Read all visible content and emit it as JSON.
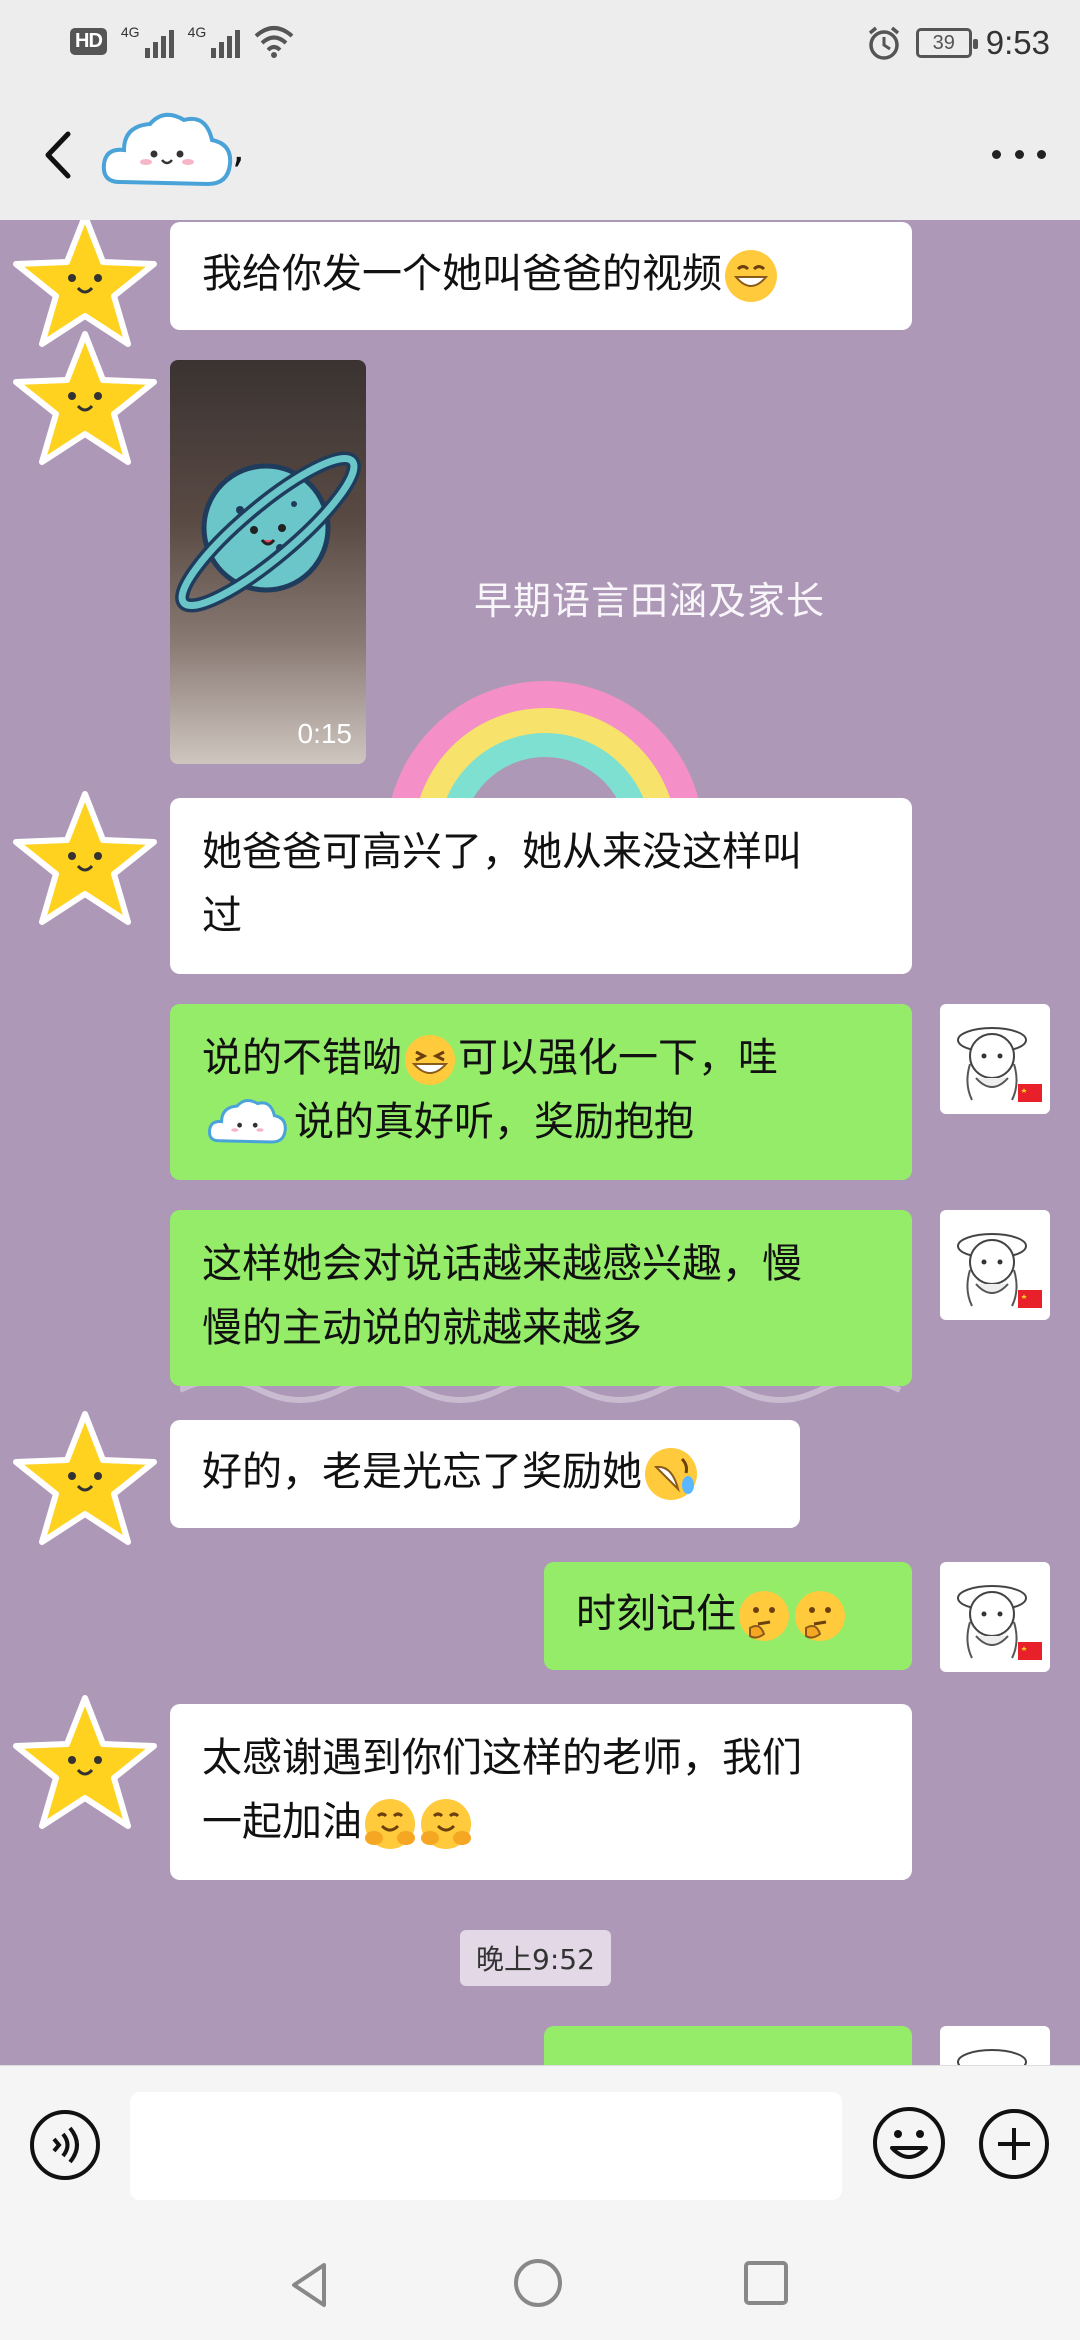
{
  "status_bar": {
    "hd": "HD",
    "sim1_label": "4G",
    "sim2_label": "4G",
    "battery": "39",
    "time": "9:53"
  },
  "header": {
    "title_suffix": ","
  },
  "background": {
    "overlay_text": "早期语言田涵及家长"
  },
  "messages": [
    {
      "side": "in",
      "text": "我给你发一个她叫爸爸的视频",
      "emoji": "grinning-face"
    },
    {
      "side": "in",
      "type": "video",
      "duration": "0:15"
    },
    {
      "side": "in",
      "line1": "她爸爸可高兴了，她从来没这样叫",
      "line2": "过"
    },
    {
      "side": "out",
      "line1a": "说的不错呦",
      "line1b": "可以强化一下，哇",
      "line2": "说的真好听，奖励抱抱",
      "emoji": "grinning-squinting-face"
    },
    {
      "side": "out",
      "line1": "这样她会对说话越来越感兴趣，慢",
      "line2": "慢的主动说的就越来越多"
    },
    {
      "side": "in",
      "text": "好的，老是光忘了奖励她",
      "emoji": "rolling-on-floor-laughing"
    },
    {
      "side": "out",
      "text": "时刻记住",
      "emoji": "thinking-face"
    },
    {
      "side": "in",
      "line1": "太感谢遇到你们这样的老师，我们",
      "line2": "一起加油",
      "emoji": "hugging-face"
    }
  ],
  "timestamp": "晚上9:52",
  "icons": {
    "voice": "voice-icon",
    "emoji": "emoji-icon",
    "plus": "plus-icon",
    "back": "back-icon",
    "more": "more-icon"
  },
  "colors": {
    "chat_bg": "#ae98b8",
    "bubble_out": "#95ec69",
    "bubble_in": "#ffffff"
  }
}
